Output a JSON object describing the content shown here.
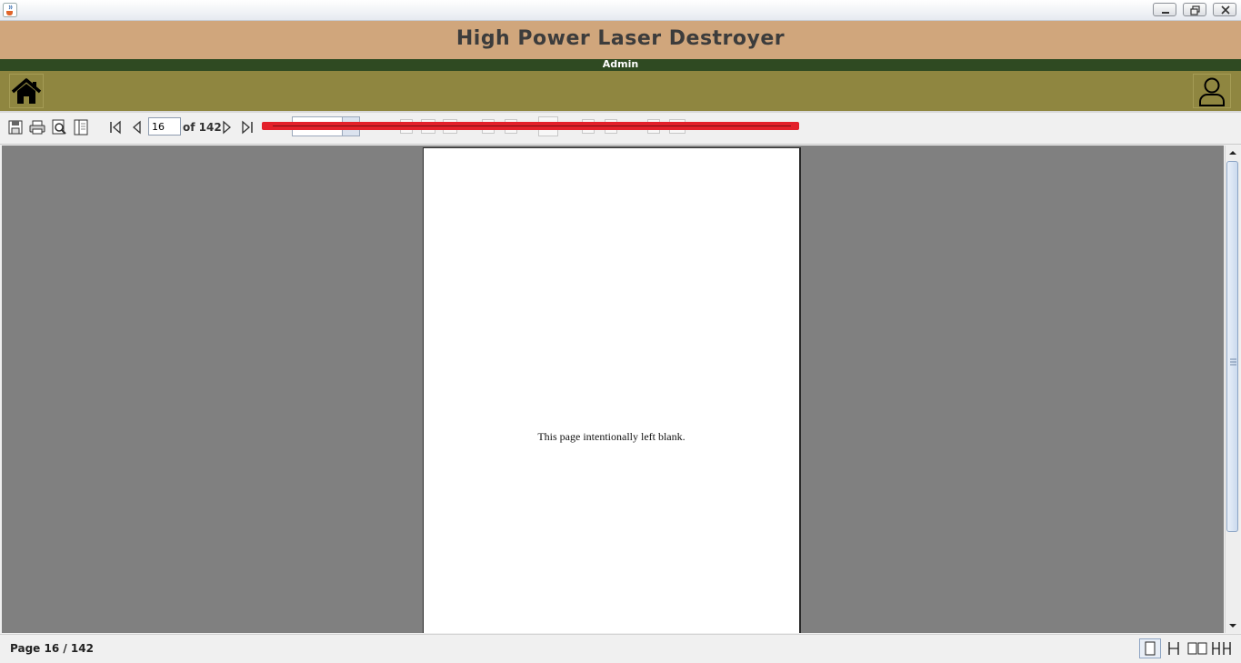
{
  "window": {
    "icon": "java-cup-icon",
    "controls": [
      "minimize-icon",
      "restore-icon",
      "close-icon"
    ]
  },
  "header": {
    "title": "High Power Laser Destroyer",
    "user_role": "Admin",
    "bg_color": "#d0a67c",
    "subheader_color": "#2f4a22",
    "nav_color": "#8f8640"
  },
  "nav": {
    "home_icon": "home-icon",
    "profile_icon": "user-icon"
  },
  "toolbar": {
    "tools": [
      "save-icon",
      "print-icon",
      "print-preview-icon",
      "page-setup-icon"
    ],
    "navigation": [
      "first-page-icon",
      "previous-page-icon",
      "next-page-icon",
      "last-page-icon"
    ],
    "current_page": "16",
    "page_total_label": "of 142",
    "redaction_color": "#e3202a"
  },
  "document": {
    "page_text": "This page intentionally left blank.",
    "viewer_bg": "#808080"
  },
  "status": {
    "text": "Page 16 / 142",
    "view_modes": [
      "single-page-icon",
      "continuous-page-icon",
      "facing-pages-icon",
      "continuous-facing-icon"
    ]
  }
}
